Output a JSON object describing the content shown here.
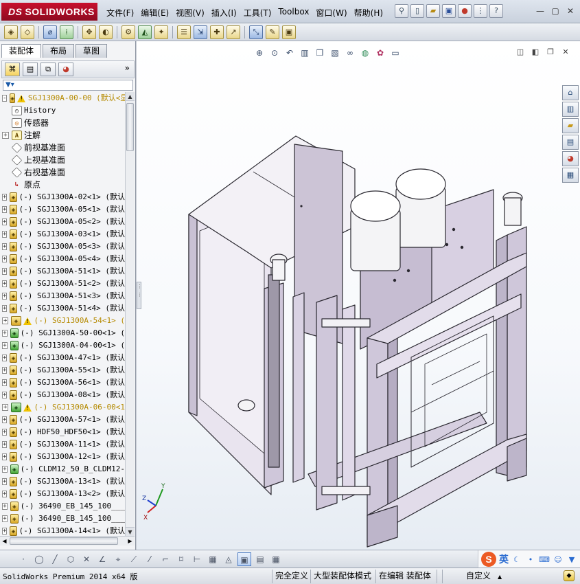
{
  "app": {
    "brand_prefix": "DS",
    "brand_name": "SOLIDWORKS"
  },
  "menu": [
    "文件(F)",
    "编辑(E)",
    "视图(V)",
    "插入(I)",
    "工具(T)",
    "Toolbox",
    "窗口(W)",
    "帮助(H)"
  ],
  "panel_tabs": [
    "装配体",
    "布局",
    "草图"
  ],
  "more_label": "»",
  "filter_icon": "filter-icon",
  "tree": [
    {
      "label": "SGJ1300A-00-00  (默认<显",
      "type": "root",
      "warn": true,
      "style": "yellow",
      "exp": "-"
    },
    {
      "label": "History",
      "type": "hist",
      "exp": ""
    },
    {
      "label": "传感器",
      "type": "sens",
      "exp": "",
      "style": "sans"
    },
    {
      "label": "注解",
      "type": "ann",
      "exp": "+",
      "style": "sans"
    },
    {
      "label": "前视基准面",
      "type": "plane",
      "exp": "",
      "style": "sans"
    },
    {
      "label": "上视基准面",
      "type": "plane",
      "exp": "",
      "style": "sans"
    },
    {
      "label": "右视基准面",
      "type": "plane",
      "exp": "",
      "style": "sans"
    },
    {
      "label": "原点",
      "type": "orig",
      "exp": "",
      "style": "sans"
    },
    {
      "label": "(-) SGJ1300A-02<1> (默认",
      "type": "asm",
      "exp": "+"
    },
    {
      "label": "(-) SGJ1300A-05<1> (默认",
      "type": "asm",
      "exp": "+"
    },
    {
      "label": "(-) SGJ1300A-05<2> (默认",
      "type": "asm",
      "exp": "+"
    },
    {
      "label": "(-) SGJ1300A-03<1> (默认",
      "type": "asm",
      "exp": "+"
    },
    {
      "label": "(-) SGJ1300A-05<3> (默认",
      "type": "asm",
      "exp": "+"
    },
    {
      "label": "(-) SGJ1300A-05<4> (默认",
      "type": "asm",
      "exp": "+"
    },
    {
      "label": "(-) SGJ1300A-51<1> (默认",
      "type": "asm",
      "exp": "+"
    },
    {
      "label": "(-) SGJ1300A-51<2> (默认",
      "type": "asm",
      "exp": "+"
    },
    {
      "label": "(-) SGJ1300A-51<3> (默认",
      "type": "asm",
      "exp": "+"
    },
    {
      "label": "(-) SGJ1300A-51<4> (默认",
      "type": "asm",
      "exp": "+"
    },
    {
      "label": "(-) SGJ1300A-54<1> (",
      "type": "asm",
      "warn": true,
      "style": "yellow",
      "exp": "+"
    },
    {
      "label": "(-) SGJ1300A-50-00<1> (",
      "type": "asmg",
      "exp": "+"
    },
    {
      "label": "(-) SGJ1300A-04-00<1> (",
      "type": "asmg",
      "exp": "+"
    },
    {
      "label": "(-) SGJ1300A-47<1> (默认",
      "type": "asm",
      "exp": "+"
    },
    {
      "label": "(-) SGJ1300A-55<1> (默认",
      "type": "asm",
      "exp": "+"
    },
    {
      "label": "(-) SGJ1300A-56<1> (默认",
      "type": "asm",
      "exp": "+"
    },
    {
      "label": "(-) SGJ1300A-08<1> (默认",
      "type": "asm",
      "exp": "+"
    },
    {
      "label": "(-) SGJ1300A-06-00<1",
      "type": "asmg",
      "warn": true,
      "style": "yellow",
      "exp": "+"
    },
    {
      "label": "(-) SGJ1300A-57<1> (默认",
      "type": "asm",
      "exp": "+"
    },
    {
      "label": "(-) HDF50_HDF50<1> (默认",
      "type": "asm",
      "exp": "+"
    },
    {
      "label": "(-) SGJ1300A-11<1> (默认",
      "type": "asm",
      "exp": "+"
    },
    {
      "label": "(-) SGJ1300A-12<1> (默认",
      "type": "asm",
      "exp": "+"
    },
    {
      "label": "(-) CLDM12_50_B_CLDM12-",
      "type": "asmg",
      "exp": "+"
    },
    {
      "label": "(-) SGJ1300A-13<1> (默认",
      "type": "asm",
      "exp": "+"
    },
    {
      "label": "(-) SGJ1300A-13<2> (默认",
      "type": "asm",
      "exp": "+"
    },
    {
      "label": "(-) 36490_EB_145_100___",
      "type": "asm",
      "exp": "+"
    },
    {
      "label": "(-) 36490_EB_145_100___",
      "type": "asm",
      "exp": "+"
    },
    {
      "label": "(-) SGJ1300A-14<1> (默认",
      "type": "asm",
      "exp": "+"
    }
  ],
  "status": {
    "product": "SolidWorks Premium 2014 x64 版",
    "defined": "完全定义",
    "mode": "大型装配体模式",
    "editing": "在编辑 装配体",
    "units": "自定义"
  },
  "ime": {
    "logo": "S",
    "lang": "英"
  },
  "triad": {
    "x": "X",
    "y": "Y",
    "z": "Z"
  },
  "colors": {
    "brand": "#c8102e",
    "warn": "#f0c300",
    "model_fill": "#ded7e6",
    "model_edge": "#2a2830"
  }
}
